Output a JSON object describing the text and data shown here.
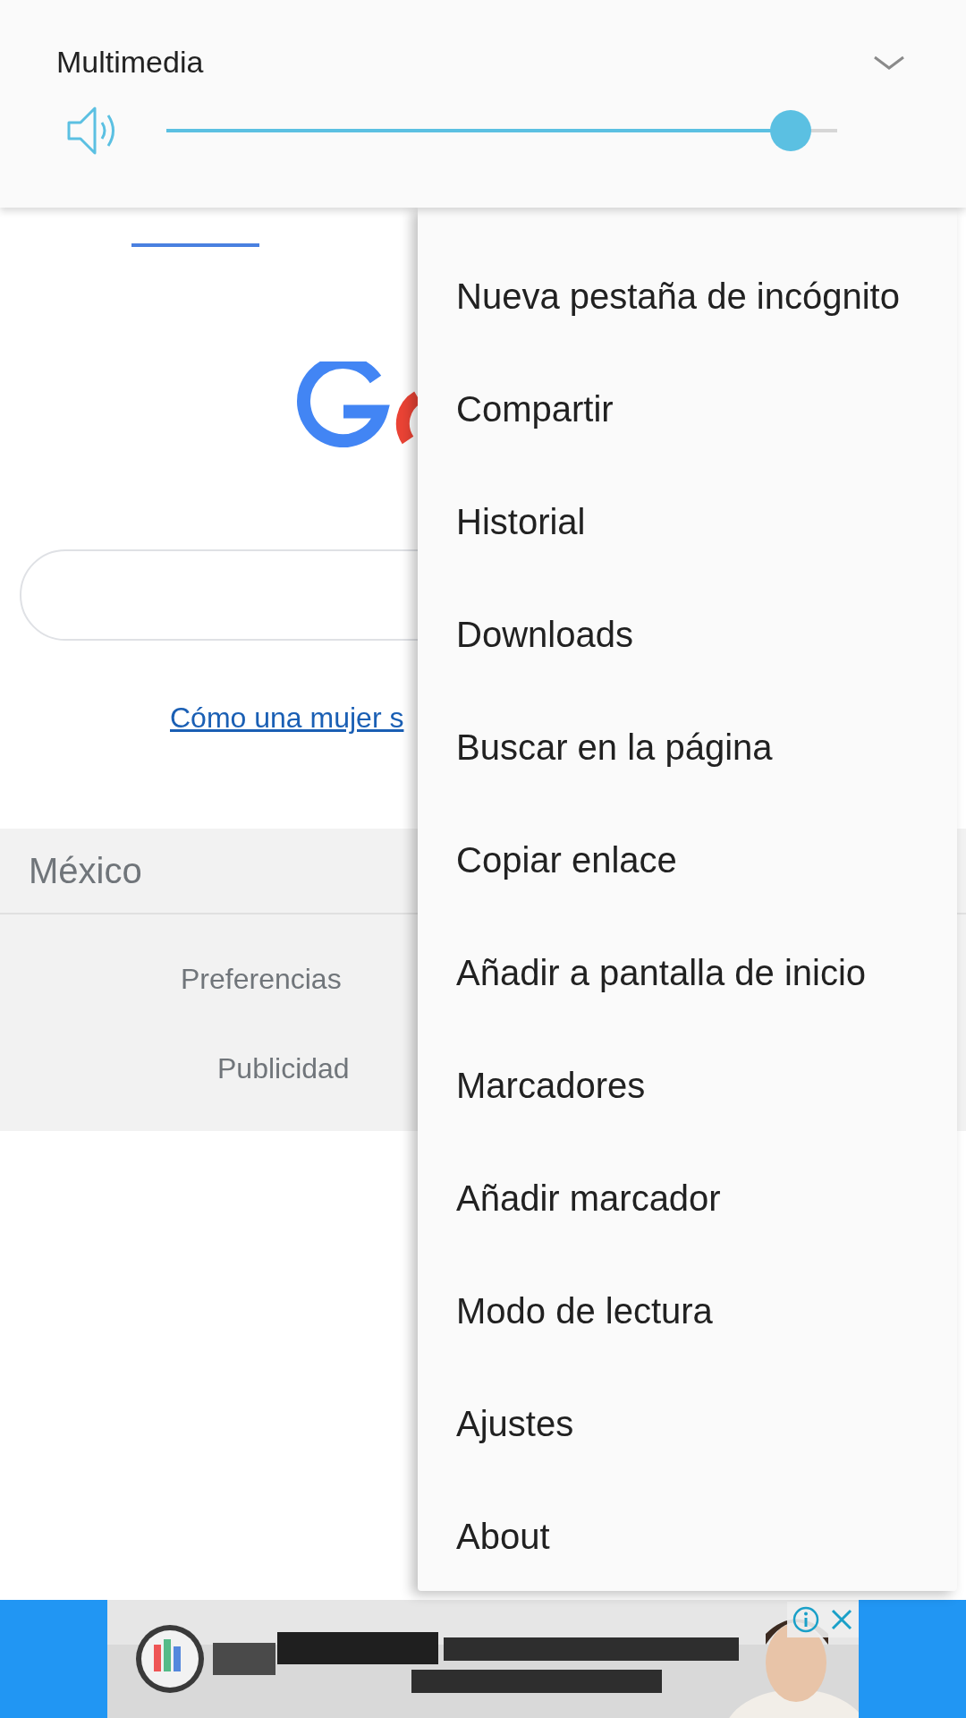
{
  "volume_panel": {
    "title": "Multimedia",
    "expanded": false,
    "level": 0.93
  },
  "page": {
    "link": "Cómo una mujer s",
    "country": "México",
    "footer_links": [
      "Preferencias",
      "Publicidad"
    ]
  },
  "menu": {
    "items": [
      "Nueva pestaña de incógnito",
      "Compartir",
      "Historial",
      "Downloads",
      "Buscar en la página",
      "Copiar enlace",
      "Añadir a pantalla de inicio",
      "Marcadores",
      "Añadir marcador",
      "Modo de lectura",
      "Ajustes",
      "About"
    ]
  }
}
